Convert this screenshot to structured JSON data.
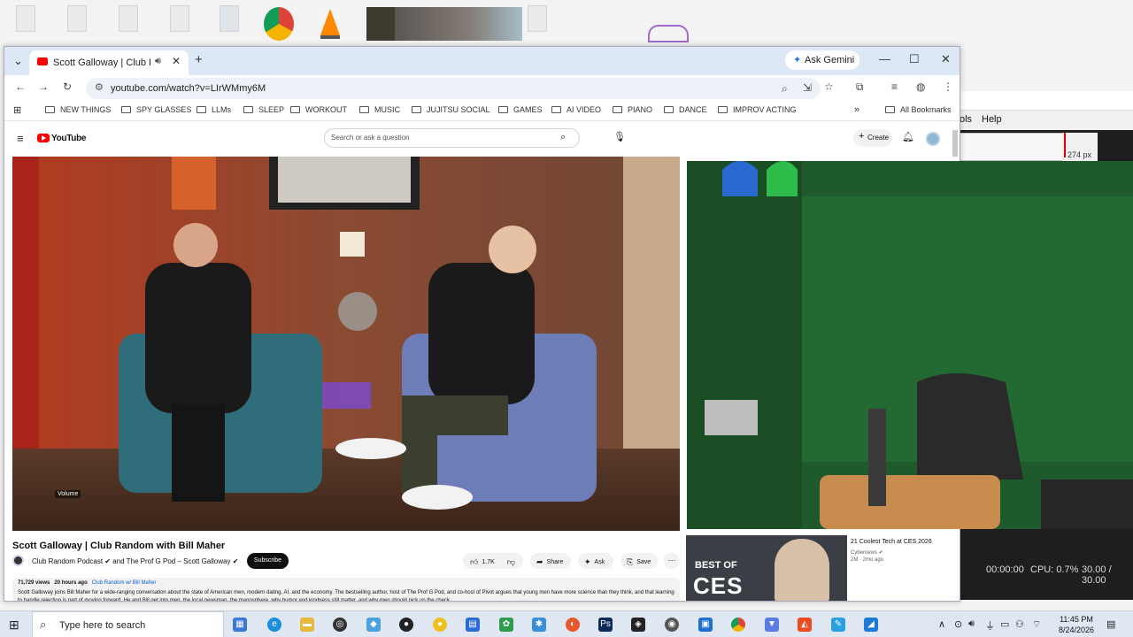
{
  "browser": {
    "tab_title": "Scott Galloway | Club Rand",
    "ask_gemini": "Ask Gemini",
    "url": "youtube.com/watch?v=LIrWMmy6M",
    "bookmarks": [
      "NEW THINGS",
      "SPY GLASSES",
      "LLMs",
      "SLEEP",
      "WORKOUT",
      "MUSIC",
      "JUJITSU SOCIAL",
      "GAMES",
      "AI VIDEO",
      "PIANO",
      "DANCE",
      "IMPROV ACTING"
    ],
    "all_bookmarks": "All Bookmarks"
  },
  "youtube": {
    "logo_text": "YouTube",
    "search_placeholder": "Search or ask a question",
    "create_label": "Create",
    "volume_tooltip": "Volume",
    "video_title": "Scott Galloway | Club Random with Bill Maher",
    "channel": "Club Random Podcast",
    "channel_collab": "and The Prof G Pod – Scott Galloway",
    "subscribe_label": "Subscribe",
    "actions": {
      "likes": "1.7K",
      "share": "Share",
      "ask": "Ask",
      "save": "Save"
    },
    "description": {
      "views": "71,729 views",
      "posted": "20 hours ago",
      "playlist": "Club Random w/ Bill Maher",
      "text": "Scott Galloway joins Bill Maher for a wide-ranging conversation about the state of American men, modern dating, AI, and the economy. The bestselling author, host of The Prof G Pod, and co-host of Pivot argues that young men have more science than they think, and that learning to handle rejection is part of moving forward. He and Bill get into men, the local newsman, the manosphere, why humor and kindness still matter, and why men should pick up the check."
    },
    "recommendation": {
      "title": "21 Coolest Tech at CES 2026",
      "channel": "Cybernews",
      "meta": "2M · 2mo ago",
      "thumb_line1": "BEST OF",
      "thumb_line2": "CES"
    }
  },
  "background_app": {
    "menu_partial": "ols",
    "menu_help": "Help",
    "dimension": "274 px",
    "time": "00:00:00",
    "cpu": "CPU: 0.7%",
    "fps": "30.00 / 30.00"
  },
  "taskbar": {
    "search_placeholder": "Type here to search",
    "time": "11:45 PM",
    "date": "8/24/2026"
  }
}
